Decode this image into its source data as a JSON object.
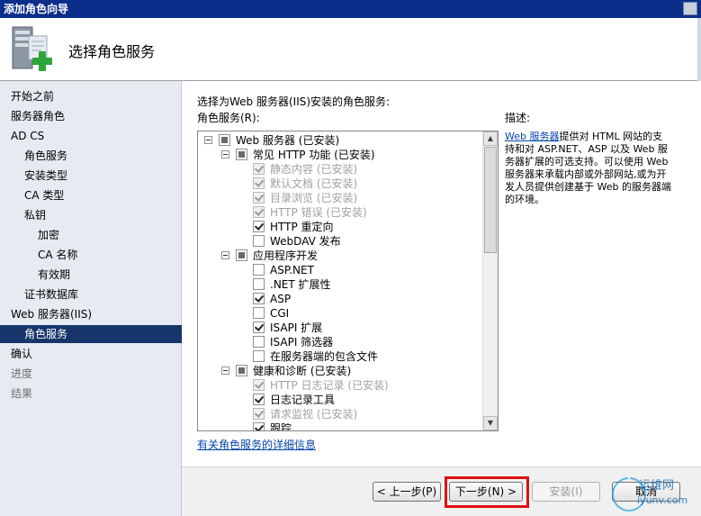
{
  "window": {
    "title": "添加角色向导"
  },
  "header": {
    "page_title": "选择角色服务"
  },
  "sidebar": {
    "items": [
      {
        "label": "开始之前",
        "state": "normal"
      },
      {
        "label": "服务器角色",
        "state": "normal"
      },
      {
        "label": "AD CS",
        "state": "normal"
      },
      {
        "label": "角色服务",
        "state": "normal"
      },
      {
        "label": "安装类型",
        "state": "normal"
      },
      {
        "label": "CA 类型",
        "state": "normal"
      },
      {
        "label": "私钥",
        "state": "normal"
      },
      {
        "label": "加密",
        "state": "normal"
      },
      {
        "label": "CA 名称",
        "state": "normal"
      },
      {
        "label": "有效期",
        "state": "normal"
      },
      {
        "label": "证书数据库",
        "state": "normal"
      },
      {
        "label": "Web 服务器(IIS)",
        "state": "normal"
      },
      {
        "label": "角色服务",
        "state": "selected"
      },
      {
        "label": "确认",
        "state": "normal"
      },
      {
        "label": "进度",
        "state": "disabled"
      },
      {
        "label": "结果",
        "state": "disabled"
      }
    ]
  },
  "main": {
    "instruction": "选择为Web 服务器(IIS)安装的角色服务:",
    "list_label": "角色服务(R):",
    "tree": [
      {
        "label": "Web 服务器  (已安装)",
        "check": "indeterminate",
        "expander": true,
        "grey": false
      },
      {
        "label": "常见 HTTP 功能  (已安装)",
        "check": "indeterminate",
        "expander": true,
        "grey": false
      },
      {
        "label": "静态内容  (已安装)",
        "check": "checked",
        "expander": false,
        "grey": true
      },
      {
        "label": "默认文档  (已安装)",
        "check": "checked",
        "expander": false,
        "grey": true
      },
      {
        "label": "目录浏览  (已安装)",
        "check": "checked",
        "expander": false,
        "grey": true
      },
      {
        "label": "HTTP 错误  (已安装)",
        "check": "checked",
        "expander": false,
        "grey": true
      },
      {
        "label": "HTTP 重定向",
        "check": "checked",
        "expander": false,
        "grey": false
      },
      {
        "label": "WebDAV 发布",
        "check": "unchecked",
        "expander": false,
        "grey": false
      },
      {
        "label": "应用程序开发",
        "check": "indeterminate",
        "expander": true,
        "grey": false
      },
      {
        "label": "ASP.NET",
        "check": "unchecked",
        "expander": false,
        "grey": false
      },
      {
        "label": ".NET 扩展性",
        "check": "unchecked",
        "expander": false,
        "grey": false
      },
      {
        "label": "ASP",
        "check": "checked",
        "expander": false,
        "grey": false
      },
      {
        "label": "CGI",
        "check": "unchecked",
        "expander": false,
        "grey": false
      },
      {
        "label": "ISAPI 扩展",
        "check": "checked",
        "expander": false,
        "grey": false
      },
      {
        "label": "ISAPI 筛选器",
        "check": "unchecked",
        "expander": false,
        "grey": false
      },
      {
        "label": "在服务器端的包含文件",
        "check": "unchecked",
        "expander": false,
        "grey": false
      },
      {
        "label": "健康和诊断  (已安装)",
        "check": "indeterminate",
        "expander": true,
        "grey": false
      },
      {
        "label": "HTTP 日志记录  (已安装)",
        "check": "checked",
        "expander": false,
        "grey": true
      },
      {
        "label": "日志记录工具",
        "check": "checked",
        "expander": false,
        "grey": false
      },
      {
        "label": "请求监视  (已安装)",
        "check": "checked",
        "expander": false,
        "grey": true
      },
      {
        "label": "跟踪",
        "check": "checked",
        "expander": false,
        "grey": false
      }
    ],
    "more_info_link": "有关角色服务的详细信息",
    "description": {
      "label": "描述:",
      "link": "Web 服务器",
      "text": "提供对 HTML 网站的支持和对 ASP.NET、ASP 以及 Web 服务器扩展的可选支持。可以使用 Web 服务器来承载内部或外部网站,或为开发人员提供创建基于 Web 的服务器端的环境。"
    }
  },
  "footer": {
    "prev_label": "< 上一步(P)",
    "next_label": "下一步(N) >",
    "install_label": "安装(I)",
    "cancel_label": "取消"
  },
  "watermark": {
    "text1": "运维网",
    "text2": "iyunv.com"
  },
  "colors": {
    "title_bar": "#0b2e8a",
    "sidebar_bg": "#e7ebf1",
    "selected": "#17356b",
    "highlight": "#e01010",
    "link": "#0645ad"
  }
}
